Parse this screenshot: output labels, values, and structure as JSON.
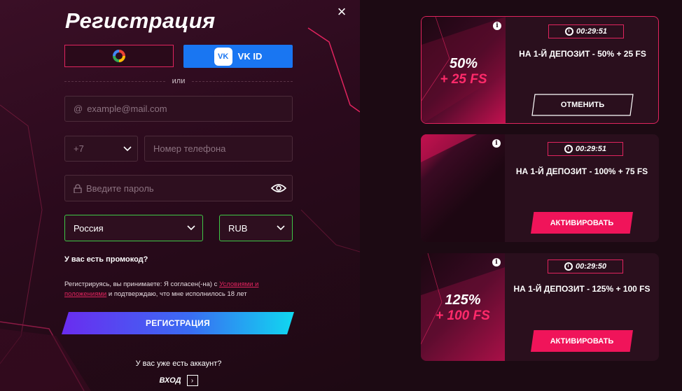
{
  "colors": {
    "accent": "#e0245e",
    "vk_blue": "#1976f2",
    "valid_border": "#3ec846",
    "bg": "#1f0c17"
  },
  "registration": {
    "title": "Регистрация",
    "close_icon": "close-icon",
    "google_icon": "google-icon",
    "vk_label": "VK ID",
    "vk_logo_text": "VK",
    "or_text": "или",
    "email_placeholder": "example@mail.com",
    "phone_code": "+7",
    "phone_placeholder": "Номер телефона",
    "password_placeholder": "Введите пароль",
    "country": "Россия",
    "currency": "RUB",
    "promo_text": "У вас есть промокод?",
    "terms_prefix": "Регистрируясь, вы принимаете: Я согласен(-на) с ",
    "terms_link": "Условиями и положениями",
    "terms_suffix": " и подтверждаю, что мне исполнилось 18 лет",
    "register_button": "РЕГИСТРАЦИЯ",
    "have_account_text": "У вас уже есть аккаунт?",
    "login_label": "ВХОД",
    "login_arrow": "›"
  },
  "bonuses": [
    {
      "percent": "50%",
      "fs": "+ 25 FS",
      "timer": "00:29:51",
      "offer": "НА 1-Й ДЕПОЗИТ - 50% + 25 FS",
      "button": "ОТМЕНИТЬ",
      "active": true
    },
    {
      "percent": "",
      "fs": "",
      "timer": "00:29:51",
      "offer": "НА 1-Й ДЕПОЗИТ - 100% + 75 FS",
      "button": "АКТИВИРОВАТЬ",
      "active": false
    },
    {
      "percent": "125%",
      "fs": "+ 100 FS",
      "timer": "00:29:50",
      "offer": "НА 1-Й ДЕПОЗИТ - 125% + 100 FS",
      "button": "АКТИВИРОВАТЬ",
      "active": false
    }
  ]
}
